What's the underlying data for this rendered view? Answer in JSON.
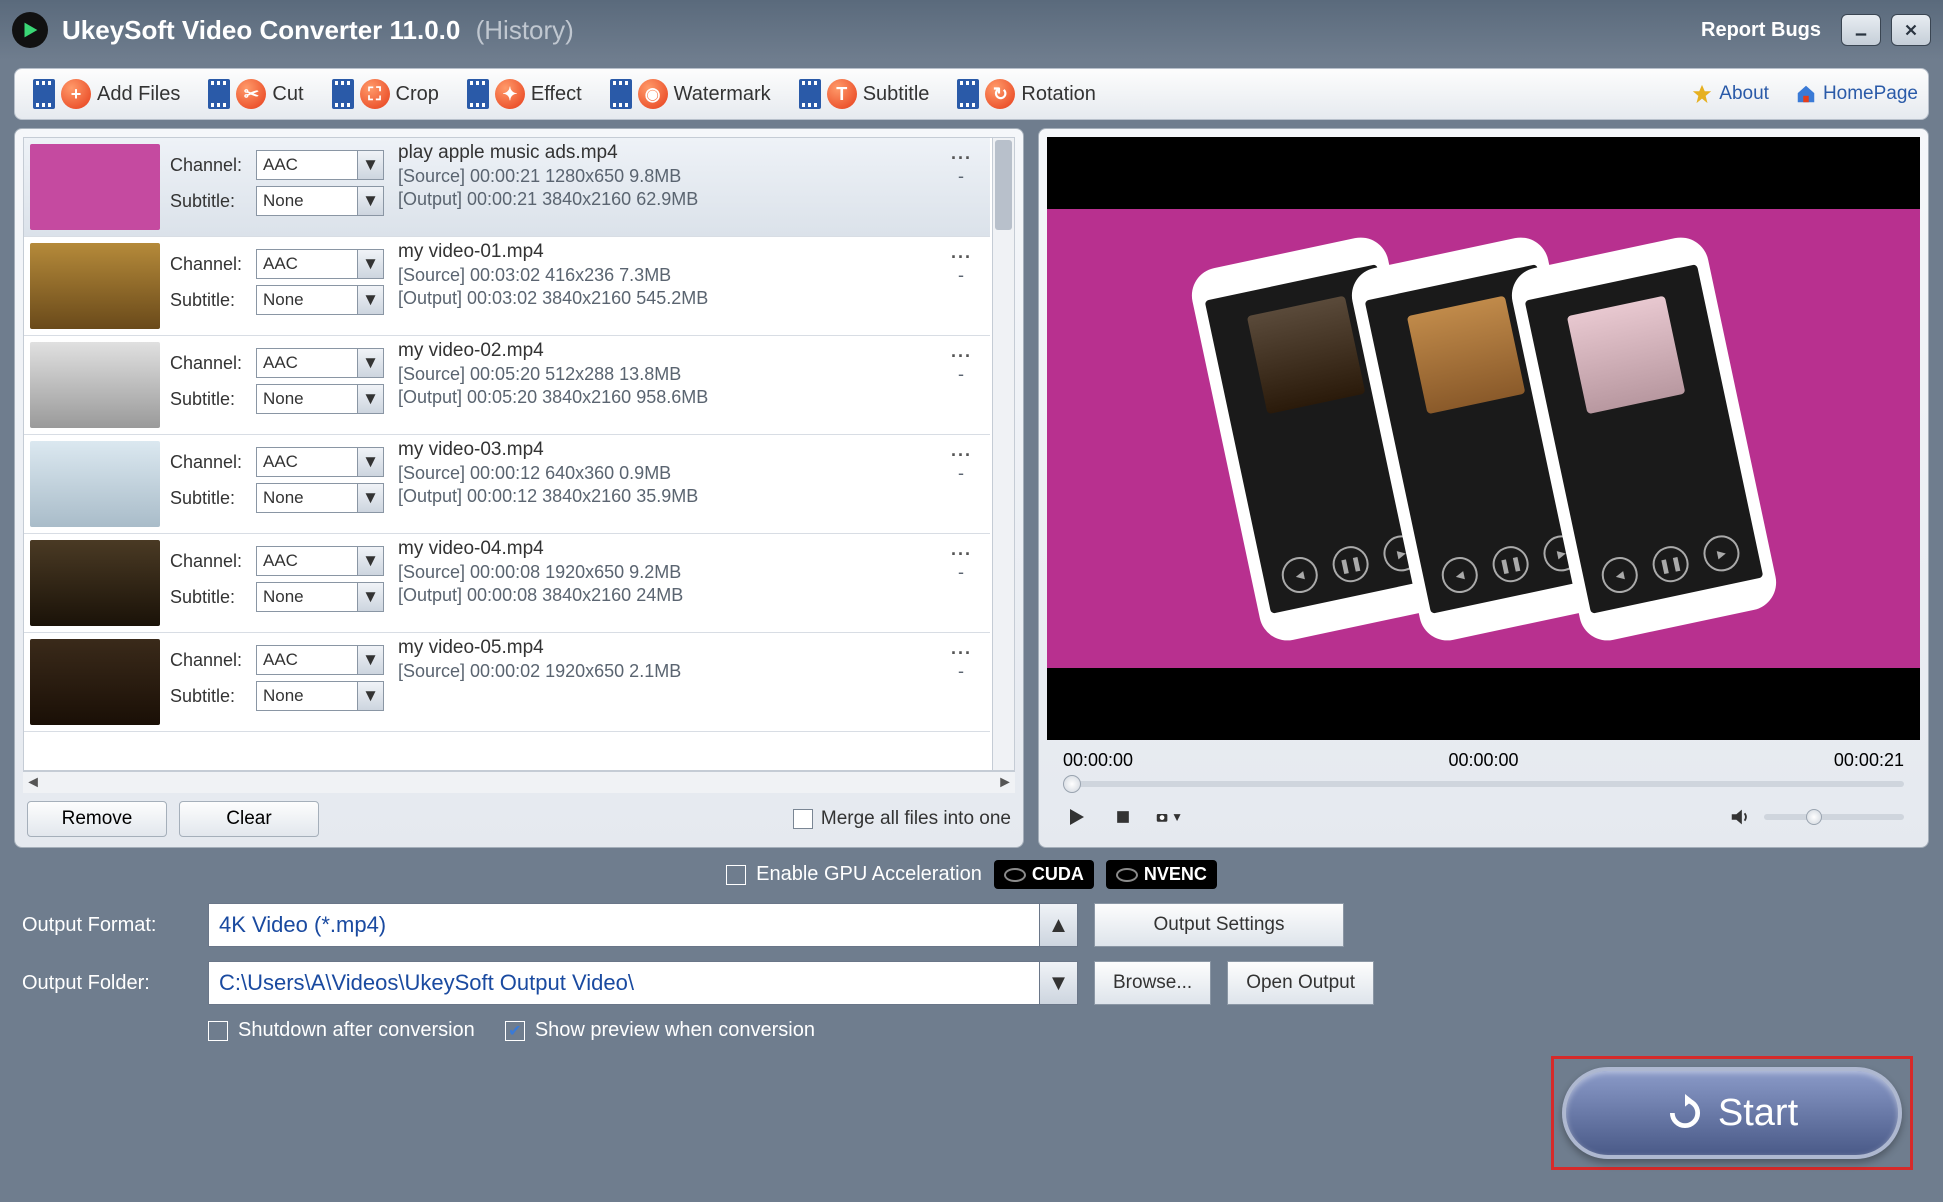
{
  "titlebar": {
    "app_name": "UkeySoft Video Converter",
    "version": "11.0.0",
    "history": "(History)",
    "report_bugs": "Report Bugs"
  },
  "toolbar": {
    "add_files": "Add Files",
    "cut": "Cut",
    "crop": "Crop",
    "effect": "Effect",
    "watermark": "Watermark",
    "subtitle": "Subtitle",
    "rotation": "Rotation",
    "about": "About",
    "homepage": "HomePage"
  },
  "list": {
    "channel_label": "Channel:",
    "subtitle_label": "Subtitle:",
    "channel_value": "AAC",
    "subtitle_value": "None",
    "remove": "Remove",
    "clear": "Clear",
    "merge": "Merge all files into one",
    "items": [
      {
        "name": "play apple music ads.mp4",
        "source": "[Source]  00:00:21  1280x650  9.8MB",
        "output": "[Output]  00:00:21  3840x2160  62.9MB",
        "thumb": "magenta"
      },
      {
        "name": "my video-01.mp4",
        "source": "[Source]  00:03:02  416x236  7.3MB",
        "output": "[Output]  00:03:02  3840x2160  545.2MB",
        "thumb": "cards"
      },
      {
        "name": "my video-02.mp4",
        "source": "[Source]  00:05:20  512x288  13.8MB",
        "output": "[Output]  00:05:20  3840x2160  958.6MB",
        "thumb": "dust"
      },
      {
        "name": "my video-03.mp4",
        "source": "[Source]  00:00:12  640x360  0.9MB",
        "output": "[Output]  00:00:12  3840x2160  35.9MB",
        "thumb": "snow"
      },
      {
        "name": "my video-04.mp4",
        "source": "[Source]  00:00:08  1920x650  9.2MB",
        "output": "[Output]  00:00:08  3840x2160  24MB",
        "thumb": "hall"
      },
      {
        "name": "my video-05.mp4",
        "source": "[Source]  00:00:02  1920x650  2.1MB",
        "output": "",
        "thumb": "horiz"
      }
    ]
  },
  "preview": {
    "t_start": "00:00:00",
    "t_mid": "00:00:00",
    "t_end": "00:00:21"
  },
  "bottom": {
    "gpu": "Enable GPU Acceleration",
    "cuda": "CUDA",
    "nvenc": "NVENC",
    "output_format_label": "Output Format:",
    "output_format_value": "4K Video (*.mp4)",
    "output_settings": "Output Settings",
    "output_folder_label": "Output Folder:",
    "output_folder_value": "C:\\Users\\A\\Videos\\UkeySoft Output Video\\",
    "browse": "Browse...",
    "open_output": "Open Output",
    "shutdown": "Shutdown after conversion",
    "show_preview": "Show preview when conversion",
    "start": "Start"
  }
}
